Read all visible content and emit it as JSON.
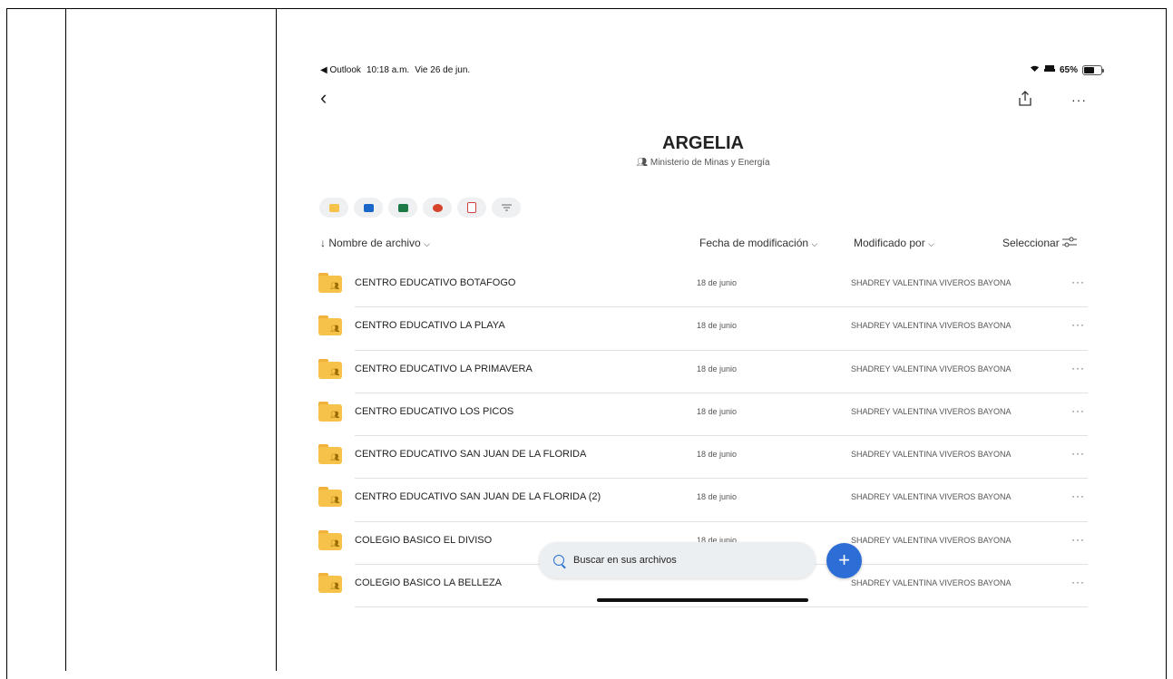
{
  "status_bar": {
    "back_app": "◀ Outlook",
    "time": "10:18 a.m.",
    "date": "Vie 26 de jun.",
    "battery": "65%"
  },
  "folder": {
    "title": "ARGELIA",
    "owner": "Ministerio de Minas y Energía"
  },
  "filters": [
    {
      "name": "folders-filter",
      "color": "#f7c24a"
    },
    {
      "name": "outlook-filter",
      "color": "#1a66c9"
    },
    {
      "name": "excel-filter",
      "color": "#1e7a45"
    },
    {
      "name": "powerpoint-filter",
      "color": "#d6452b"
    },
    {
      "name": "pdf-filter",
      "color": "#d04040"
    },
    {
      "name": "more-filters",
      "color": "#666666"
    }
  ],
  "columns": {
    "name": "Nombre de archivo",
    "date": "Fecha de modificación",
    "modified_by": "Modificado por",
    "select": "Seleccionar"
  },
  "rows": [
    {
      "name": "CENTRO EDUCATIVO BOTAFOGO",
      "date": "18 de junio",
      "modified_by": "SHADREY VALENTINA VIVEROS BAYONA"
    },
    {
      "name": "CENTRO EDUCATIVO LA PLAYA",
      "date": "18 de junio",
      "modified_by": "SHADREY VALENTINA VIVEROS BAYONA"
    },
    {
      "name": "CENTRO EDUCATIVO LA PRIMAVERA",
      "date": "18 de junio",
      "modified_by": "SHADREY VALENTINA VIVEROS BAYONA"
    },
    {
      "name": "CENTRO EDUCATIVO LOS PICOS",
      "date": "18 de junio",
      "modified_by": "SHADREY VALENTINA VIVEROS BAYONA"
    },
    {
      "name": "CENTRO EDUCATIVO SAN JUAN DE LA FLORIDA",
      "date": "18 de junio",
      "modified_by": "SHADREY VALENTINA VIVEROS BAYONA"
    },
    {
      "name": "CENTRO EDUCATIVO SAN JUAN DE LA FLORIDA (2)",
      "date": "18 de junio",
      "modified_by": "SHADREY VALENTINA VIVEROS BAYONA"
    },
    {
      "name": "COLEGIO BASICO EL DIVISO",
      "date": "18 de junio",
      "modified_by": "SHADREY VALENTINA VIVEROS BAYONA"
    },
    {
      "name": "COLEGIO BASICO LA BELLEZA",
      "date": "",
      "modified_by": "SHADREY VALENTINA VIVEROS BAYONA"
    }
  ],
  "search": {
    "placeholder": "Buscar en sus archivos"
  },
  "fab_label": "+"
}
